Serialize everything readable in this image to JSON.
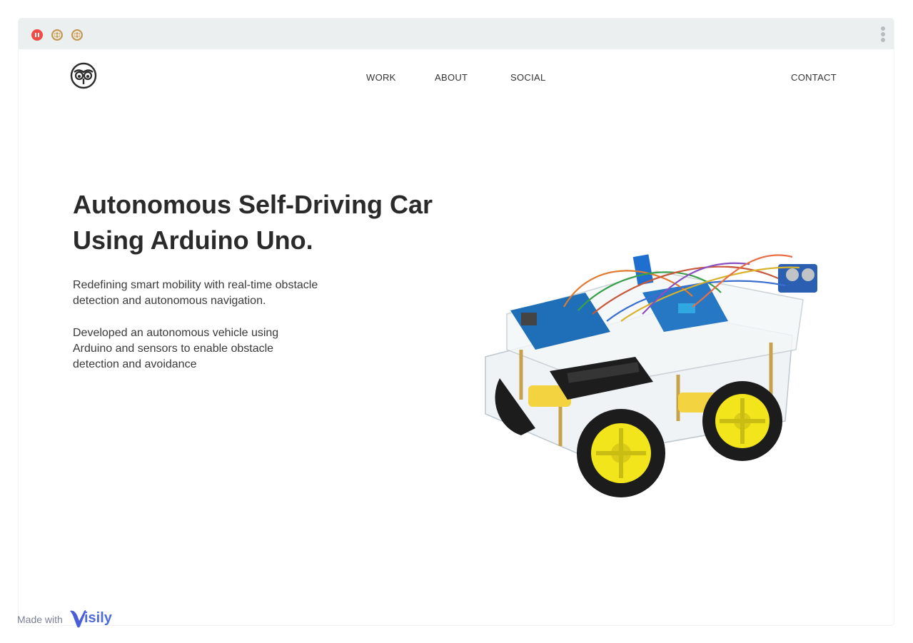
{
  "nav": {
    "work": "WORK",
    "about": "ABOUT",
    "social": "SOCIAL",
    "contact": "CONTACT"
  },
  "hero": {
    "title_line1": "Autonomous Self-Driving Car",
    "title_line2": "Using Arduino Uno.",
    "paragraph1": "Redefining smart mobility with real-time obstacle detection and autonomous navigation.",
    "paragraph2": "Developed an autonomous vehicle using Arduino and sensors to enable obstacle detection and avoidance"
  },
  "footer": {
    "made_with": "Made with",
    "brand": "isily"
  },
  "icons": {
    "browser_controls": [
      "pause-icon",
      "globe-icon",
      "globe-icon"
    ],
    "menu": "kebab-menu-icon",
    "logo": "owl-logo-icon"
  },
  "colors": {
    "browser_bar": "#eceff0",
    "pause_red": "#f24a45",
    "globe_tan": "#c49a5a",
    "title": "#2a2a2a",
    "brand_blue": "#4f6bd8"
  }
}
